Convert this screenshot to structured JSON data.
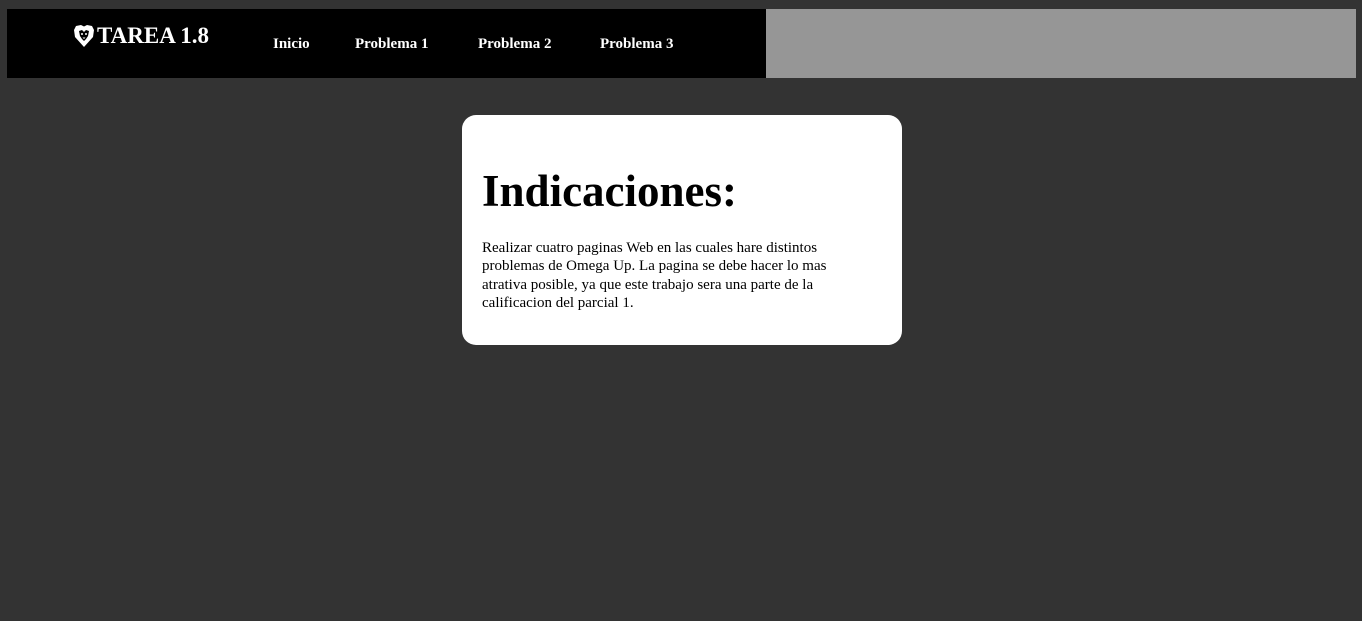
{
  "navbar": {
    "brand": "TAREA 1.8",
    "brand_icon": "lion-shield-icon",
    "links": [
      {
        "label": "Inicio"
      },
      {
        "label": "Problema 1"
      },
      {
        "label": "Problema 2"
      },
      {
        "label": "Problema 3"
      }
    ]
  },
  "main": {
    "heading": "Indicaciones:",
    "body": "Realizar cuatro paginas Web en las cuales hare distintos problemas de Omega Up. La pagina se debe hacer lo mas atrativa posible, ya que este trabajo sera una parte de la calificacion del parcial 1."
  },
  "colors": {
    "background": "#333333",
    "navbar": "#000000",
    "navbar_fill": "#969696",
    "card": "#ffffff"
  }
}
